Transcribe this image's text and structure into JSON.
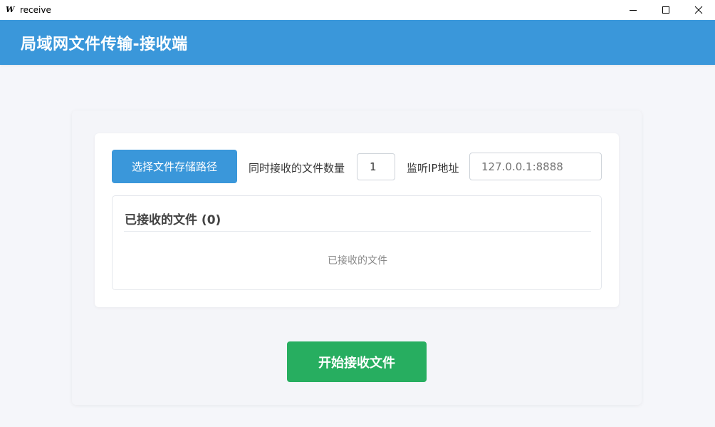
{
  "window": {
    "title": "receive",
    "icon_text": "W",
    "icon": "app-w-icon",
    "controls": [
      "minimize-icon",
      "maximize-icon",
      "close-icon"
    ]
  },
  "header": {
    "title": "局域网文件传输-接收端",
    "background": "#3a97da"
  },
  "controls": {
    "choose_path_label": "选择文件存储路径",
    "count_label": "同时接收的文件数量",
    "count_value": "1",
    "ip_label": "监听IP地址",
    "ip_placeholder": "127.0.0.1:8888"
  },
  "received": {
    "heading": "已接收的文件 (0)",
    "empty_text": "已接收的文件"
  },
  "start_button": {
    "label": "开始接收文件",
    "color": "#27ae60"
  }
}
